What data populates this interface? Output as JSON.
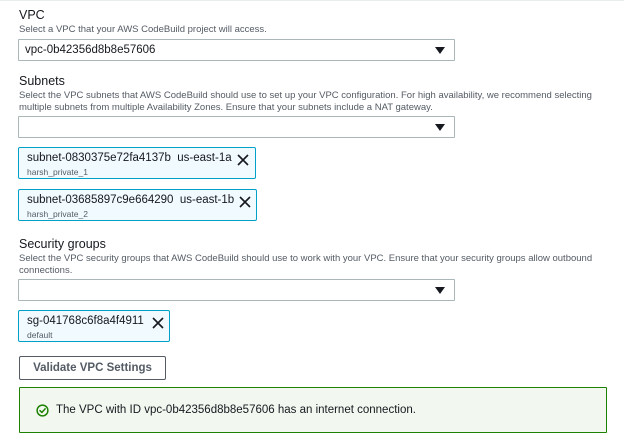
{
  "vpc": {
    "label": "VPC",
    "description": "Select a VPC that your AWS CodeBuild project will access.",
    "selected": "vpc-0b42356d8b8e57606"
  },
  "subnets": {
    "label": "Subnets",
    "description": "Select the VPC subnets that AWS CodeBuild should use to set up your VPC configuration. For high availability, we recommend selecting multiple subnets from multiple Availability Zones. Ensure that your subnets include a NAT gateway.",
    "selected": "",
    "tokens": [
      {
        "id": "subnet-0830375e72fa4137b",
        "zone": "us-east-1a",
        "name": "harsh_private_1"
      },
      {
        "id": "subnet-03685897c9e664290",
        "zone": "us-east-1b",
        "name": "harsh_private_2"
      }
    ]
  },
  "security_groups": {
    "label": "Security groups",
    "description": "Select the VPC security groups that AWS CodeBuild should use to work with your VPC. Ensure that your security groups allow outbound connections.",
    "selected": "",
    "tokens": [
      {
        "id": "sg-041768c6f8a4f4911",
        "name": "default"
      }
    ]
  },
  "validate_button": "Validate VPC Settings",
  "alert": {
    "message": "The VPC with ID vpc-0b42356d8b8e57606 has an internet connection.",
    "color": "#1d8102"
  },
  "icons": [
    "chevron-down-icon",
    "close-icon",
    "check-circle-icon"
  ]
}
